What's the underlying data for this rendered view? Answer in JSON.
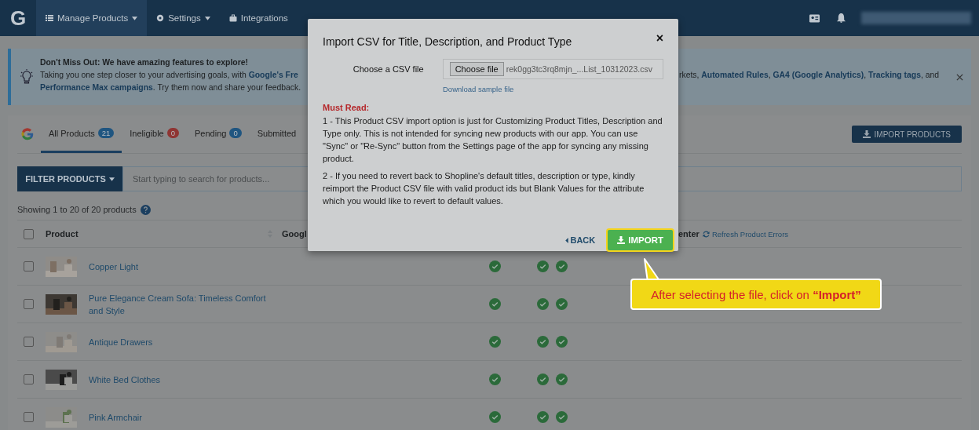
{
  "nav": {
    "logo": "G",
    "items": [
      {
        "label": "Manage Products",
        "dropdown": true,
        "selected": true
      },
      {
        "label": "Settings",
        "dropdown": true,
        "selected": false
      },
      {
        "label": "Integrations",
        "dropdown": false,
        "selected": false
      }
    ]
  },
  "banner": {
    "title": "Don't Miss Out: We have amazing features to explore!",
    "line_left": "Taking you one step closer to your advertising goals, with **Google's Fre**",
    "line_right": "rkets, **Automated Rules**, **GA4 (Google Analytics)**, **Tracking tags**, and",
    "line_2": "**Performance Max campaigns**. Try them now and share your feedback."
  },
  "tabs": [
    {
      "label": "All Products",
      "count": "21",
      "color": "#1f5580",
      "selected": true
    },
    {
      "label": "Ineligible",
      "count": "0",
      "color": "#8f3533",
      "selected": false
    },
    {
      "label": "Pending",
      "count": "0",
      "color": "#1f5580",
      "selected": false
    },
    {
      "label": "Submitted",
      "selected": false
    }
  ],
  "import_products_button": "IMPORT PRODUCTS",
  "filter_button": "FILTER PRODUCTS",
  "search": {
    "placeholder": "Start typing to search for products..."
  },
  "showing": "Showing 1 to 20 of 20 products",
  "table": {
    "select_all_checked": false,
    "columns": [
      "Product",
      "Googl",
      "enter"
    ],
    "refresh_link": "Refresh Product Errors",
    "rows": [
      {
        "name": "Copper Light",
        "checked": false
      },
      {
        "name": "Pure Elegance Cream Sofa: Timeless Comfort and Style",
        "checked": false
      },
      {
        "name": "Antique Drawers",
        "checked": false
      },
      {
        "name": "White Bed Clothes",
        "checked": false
      },
      {
        "name": "Pink Armchair",
        "checked": false
      }
    ]
  },
  "modal": {
    "title": "Import CSV for Title, Description, and Product Type",
    "close": "×",
    "file_label": "Choose a CSV file",
    "choose_button": "Choose file",
    "file_name": "rek0gg3tc3rq8mjn_...List_10312023.csv",
    "sample_link": "Download sample file",
    "must_read": "Must Read:",
    "paragraphs": [
      "1 - This Product CSV import option is just for Customizing Product Titles, Description and Type only. This is not intended for syncing new products with our app. You can use \"Sync\" or \"Re-Sync\" button from the Settings page of the app for syncing any missing product.",
      "2 - If you need to revert back to Shopline's default titles, description or type, kindly reimport the Product CSV file with valid product ids but Blank Values for the attribute which you would like to revert to default values."
    ],
    "back": "BACK",
    "import": "IMPORT"
  },
  "callout": "After selecting the file, click on **“Import”**"
}
